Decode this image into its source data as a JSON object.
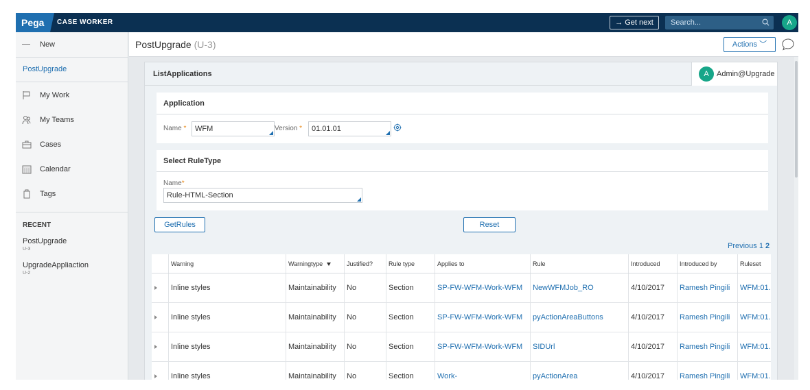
{
  "topbar": {
    "logo": "Pega",
    "portal_name": "CASE WORKER",
    "get_next_label": "Get next",
    "search_placeholder": "Search...",
    "avatar_initial": "A"
  },
  "sidebar": {
    "new_label": "New",
    "active_case": "PostUpgrade",
    "items": [
      {
        "label": "My Work",
        "icon": "flag-icon"
      },
      {
        "label": "My Teams",
        "icon": "team-icon"
      },
      {
        "label": "Cases",
        "icon": "briefcase-icon"
      },
      {
        "label": "Calendar",
        "icon": "calendar-icon"
      },
      {
        "label": "Tags",
        "icon": "tag-icon"
      }
    ],
    "recent_title": "RECENT",
    "recent": [
      {
        "name": "PostUpgrade",
        "id": "U-3"
      },
      {
        "name": "UpgradeAppliaction",
        "id": "U-2"
      }
    ]
  },
  "case_header": {
    "title": "PostUpgrade",
    "id": "(U-3)",
    "actions_label": "Actions"
  },
  "main": {
    "title": "ListApplications",
    "operator_initial": "A",
    "operator_name": "Admin@Upgrade",
    "application": {
      "title": "Application",
      "name_label": "Name",
      "name_value": "WFM",
      "version_label": "Version",
      "version_value": "01.01.01"
    },
    "ruletype": {
      "title": "Select RuleType",
      "name_label": "Name",
      "name_value": "Rule-HTML-Section"
    },
    "getrules_label": "GetRules",
    "reset_label": "Reset",
    "pager": {
      "label": "Previous",
      "page1": "1",
      "page2": "2"
    },
    "table": {
      "columns": [
        "Warning",
        "Warningtype",
        "Justified?",
        "Rule type",
        "Applies to",
        "Rule",
        "Introduced",
        "Introduced by",
        "Ruleset"
      ],
      "rows": [
        [
          "Inline styles",
          "Maintainability",
          "No",
          "Section",
          "SP-FW-WFM-Work-WFM",
          "NewWFMJob_RO",
          "4/10/2017",
          "Ramesh Pingili",
          "WFM:01..."
        ],
        [
          "Inline styles",
          "Maintainability",
          "No",
          "Section",
          "SP-FW-WFM-Work-WFM",
          "pyActionAreaButtons",
          "4/10/2017",
          "Ramesh Pingili",
          "WFM:01..."
        ],
        [
          "Inline styles",
          "Maintainability",
          "No",
          "Section",
          "SP-FW-WFM-Work-WFM",
          "SIDUrl",
          "4/10/2017",
          "Ramesh Pingili",
          "WFM:01..."
        ],
        [
          "Inline styles",
          "Maintainability",
          "No",
          "Section",
          "Work-",
          "pyActionArea",
          "4/10/2017",
          "Ramesh Pingili",
          "WFM:01..."
        ]
      ]
    }
  },
  "colors": {
    "brand": "#0b3052",
    "accent": "#1f6fb0",
    "avatar": "#17a689",
    "required": "#e88a1a"
  }
}
